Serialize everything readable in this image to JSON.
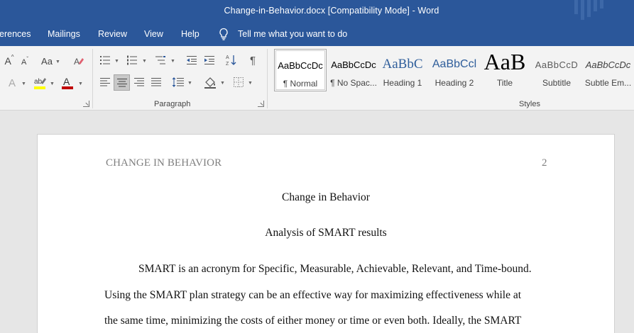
{
  "window": {
    "title": "Change-in-Behavior.docx [Compatibility Mode]  -  Word"
  },
  "tabs": [
    {
      "label": "erences"
    },
    {
      "label": "Mailings"
    },
    {
      "label": "Review"
    },
    {
      "label": "View"
    },
    {
      "label": "Help"
    },
    {
      "label": "Tell me what you want to do"
    }
  ],
  "ribbon": {
    "paragraph_group_label": "Paragraph",
    "styles_group_label": "Styles",
    "font_case_label": "Aa",
    "styles": [
      {
        "sample": "AaBbCcDc",
        "name": "¶ Normal",
        "selected": true
      },
      {
        "sample": "AaBbCcDc",
        "name": "¶ No Spac..."
      },
      {
        "sample": "AaBbC",
        "name": "Heading 1"
      },
      {
        "sample": "AaBbCcl",
        "name": "Heading 2"
      },
      {
        "sample": "AaB",
        "name": "Title"
      },
      {
        "sample": "AaBbCcD",
        "name": "Subtitle"
      },
      {
        "sample": "AaBbCcDc",
        "name": "Subtle Em..."
      }
    ],
    "colors": {
      "highlight": "#ffff00",
      "font_color": "#c00000"
    }
  },
  "document": {
    "running_head": "CHANGE IN BEHAVIOR",
    "page_number": "2",
    "title": "Change in Behavior",
    "subtitle": "Analysis of SMART results",
    "lines": [
      "SMART is an acronym for Specific, Measurable, Achievable, Relevant, and Time-bound.",
      "Using the SMART plan strategy can be an effective way for maximizing effectiveness while at",
      "the same time, minimizing the costs of either money or time or even both. Ideally, the SMART"
    ]
  }
}
